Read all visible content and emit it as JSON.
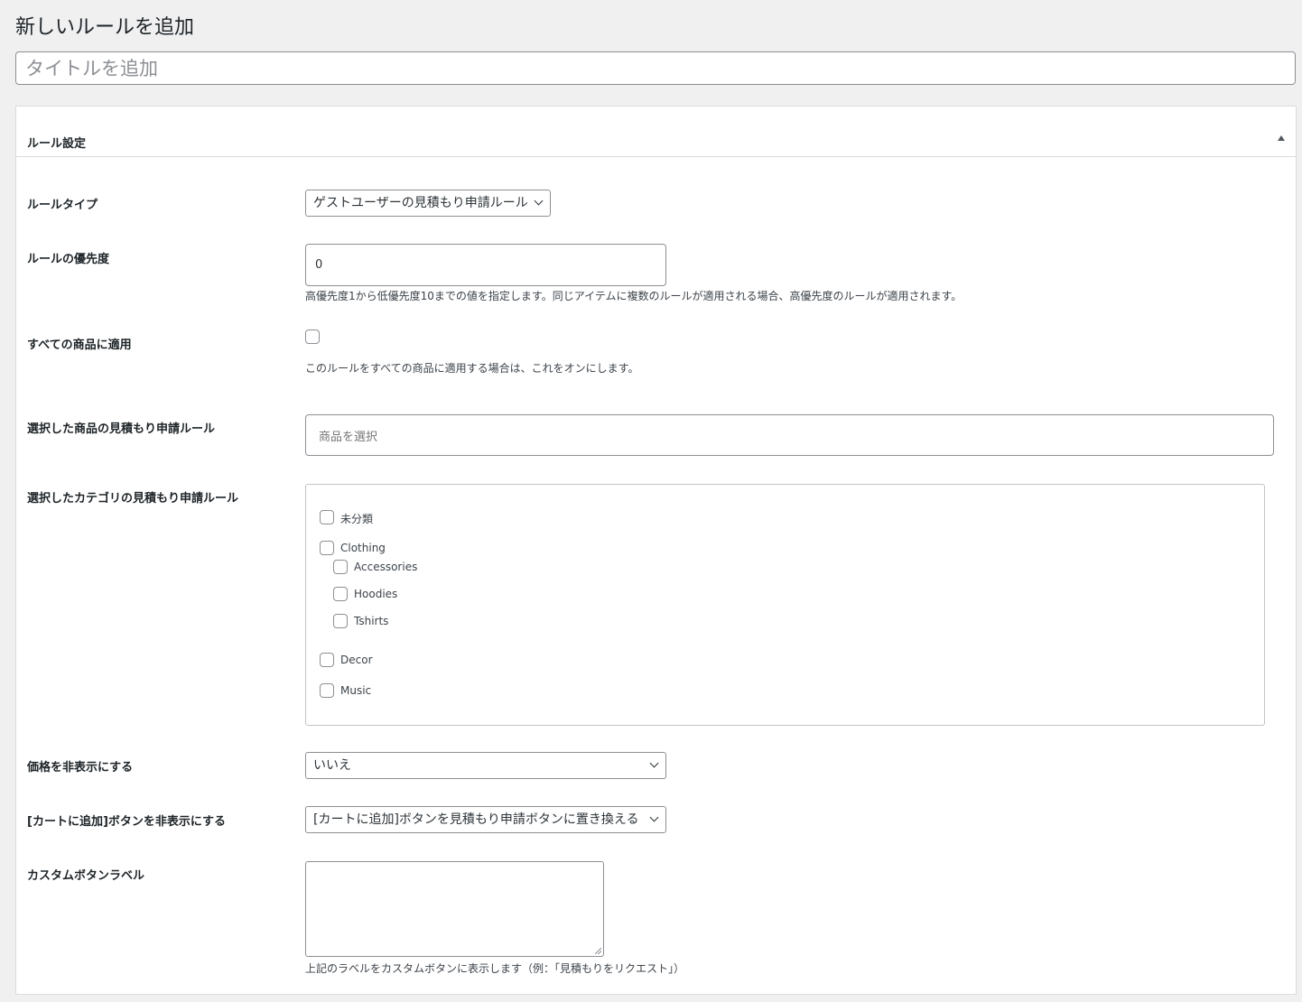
{
  "page": {
    "title": "新しいルールを追加",
    "title_placeholder": "タイトルを追加"
  },
  "postbox": {
    "title": "ルール設定",
    "fields": {
      "rule_type": {
        "label": "ルールタイプ",
        "value": "ゲストユーザーの見積もり申請ルール"
      },
      "priority": {
        "label": "ルールの優先度",
        "value": "0",
        "description": "高優先度1から低優先度10までの値を指定します。同じアイテムに複数のルールが適用される場合、高優先度のルールが適用されます。"
      },
      "apply_all": {
        "label": "すべての商品に適用",
        "checked": false,
        "description": "このルールをすべての商品に適用する場合は、これをオンにします。"
      },
      "selected_products": {
        "label": "選択した商品の見積もり申請ルール",
        "placeholder": "商品を選択"
      },
      "selected_categories": {
        "label": "選択したカテゴリの見積もり申請ルール",
        "items": [
          {
            "label": "未分類",
            "checked": false
          },
          {
            "label": "Clothing",
            "checked": false
          },
          {
            "label": "Accessories",
            "checked": false
          },
          {
            "label": "Hoodies",
            "checked": false
          },
          {
            "label": "Tshirts",
            "checked": false
          },
          {
            "label": "Decor",
            "checked": false
          },
          {
            "label": "Music",
            "checked": false
          }
        ]
      },
      "hide_price": {
        "label": "価格を非表示にする",
        "value": "いいえ"
      },
      "hide_cart_button": {
        "label": "[カートに追加]ボタンを非表示にする",
        "value": "[カートに追加]ボタンを見積もり申請ボタンに置き換える"
      },
      "custom_button_label": {
        "label": "カスタムボタンラベル",
        "value": "",
        "description": "上記のラベルをカスタムボタンに表示します（例：「見積もりをリクエスト」）"
      }
    }
  }
}
